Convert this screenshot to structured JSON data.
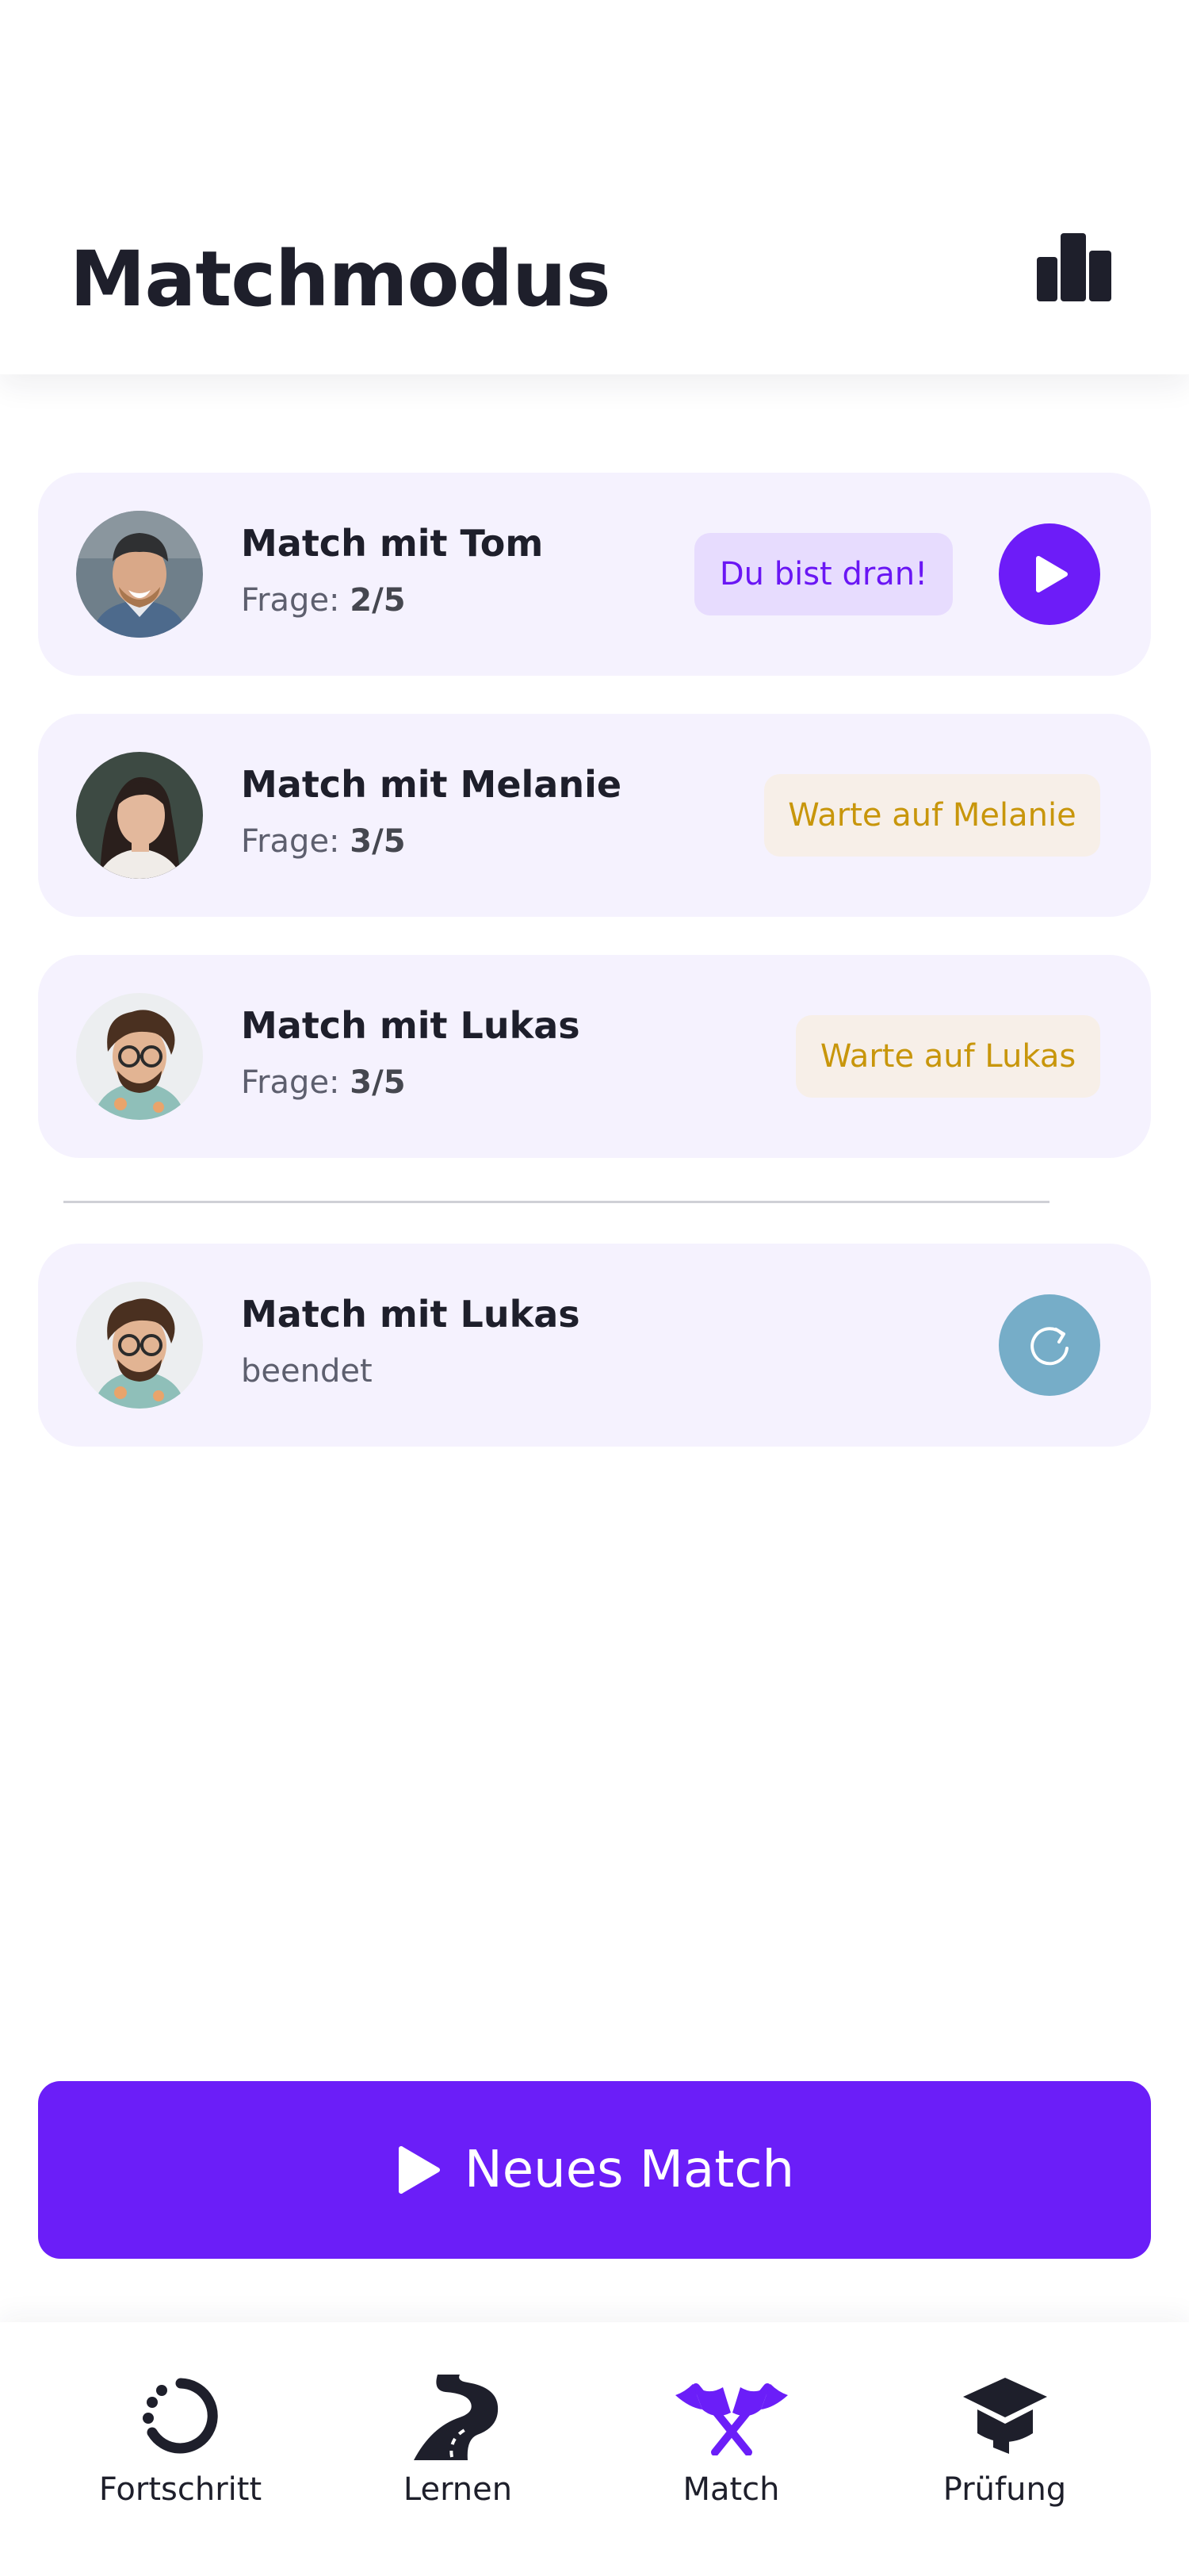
{
  "header": {
    "title": "Matchmodus",
    "stats_icon": "bar-chart-icon"
  },
  "matches": [
    {
      "title": "Match mit Tom",
      "sub_label": "Frage:",
      "sub_value": "2/5",
      "status": "Du bist dran!",
      "action_icon": "play-icon"
    },
    {
      "title": "Match mit Melanie",
      "sub_label": "Frage:",
      "sub_value": "3/5",
      "status": "Warte auf Melanie"
    },
    {
      "title": "Match mit Lukas",
      "sub_label": "Frage:",
      "sub_value": "3/5",
      "status": "Warte auf Lukas"
    }
  ],
  "finished": [
    {
      "title": "Match mit Lukas",
      "sub_label": "beendet",
      "action_icon": "restart-icon"
    }
  ],
  "cta": {
    "label": "Neues Match",
    "icon": "play-icon"
  },
  "nav": {
    "items": [
      {
        "label": "Fortschritt",
        "icon": "progress-icon"
      },
      {
        "label": "Lernen",
        "icon": "road-icon"
      },
      {
        "label": "Match",
        "icon": "crossed-flags-icon",
        "active": true
      },
      {
        "label": "Prüfung",
        "icon": "graduation-cap-icon"
      }
    ]
  },
  "colors": {
    "accent": "#6b1ef8",
    "card_bg": "#f5f2fe",
    "turn_pill_bg": "#e7dcfe",
    "turn_pill_text": "#6a16f4",
    "wait_pill_bg": "#f7efe8",
    "wait_pill_text": "#c8960b",
    "restart_bg": "#76adc8",
    "text_dark": "#1e1f2b"
  }
}
